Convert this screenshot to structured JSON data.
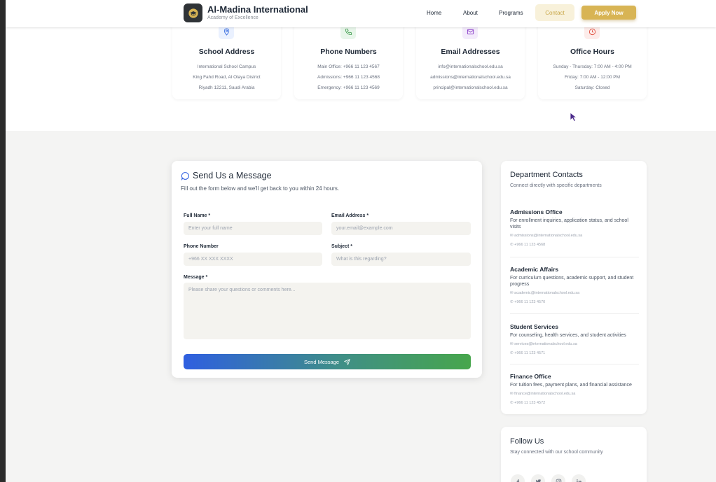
{
  "header": {
    "brand_name": "Al-Madina International",
    "brand_tagline": "Academy of Excellence",
    "nav": [
      "Home",
      "About",
      "Programs",
      "Contact"
    ],
    "apply_label": "Apply Now",
    "logo_icon": "graduation-cap-icon"
  },
  "info_cards": [
    {
      "icon": "map-pin-icon",
      "title": "School Address",
      "lines": [
        "International School Campus",
        "King Fahd Road, Al Olaya District",
        "Riyadh 12211, Saudi Arabia"
      ]
    },
    {
      "icon": "phone-icon",
      "title": "Phone Numbers",
      "lines": [
        "Main Office: +966 11 123 4567",
        "Admissions: +966 11 123 4568",
        "Emergency: +966 11 123 4569"
      ]
    },
    {
      "icon": "mail-icon",
      "title": "Email Addresses",
      "lines": [
        "info@internationalschool.edu.sa",
        "admissions@internationalschool.edu.sa",
        "principal@internationalschool.edu.sa"
      ]
    },
    {
      "icon": "clock-icon",
      "title": "Office Hours",
      "lines": [
        "Sunday - Thursday: 7:00 AM - 4:00 PM",
        "Friday: 7:00 AM - 12:00 PM",
        "Saturday: Closed"
      ]
    }
  ],
  "form": {
    "title": "Send Us a Message",
    "subtitle": "Fill out the form below and we'll get back to you within 24 hours.",
    "full_name_label": "Full Name *",
    "full_name_placeholder": "Enter your full name",
    "email_label": "Email Address *",
    "email_placeholder": "your.email@example.com",
    "phone_label": "Phone Number",
    "phone_placeholder": "+966 XX XXX XXXX",
    "subject_label": "Subject *",
    "subject_placeholder": "What is this regarding?",
    "message_label": "Message *",
    "message_placeholder": "Please share your questions or comments here...",
    "send_label": "Send Message"
  },
  "departments": {
    "title": "Department Contacts",
    "subtitle": "Connect directly with specific departments",
    "items": [
      {
        "name": "Admissions Office",
        "desc": "For enrollment inquiries, application status, and school visits",
        "email": "admissions@internationalschool.edu.sa",
        "phone": "+966 11 123 4568"
      },
      {
        "name": "Academic Affairs",
        "desc": "For curriculum questions, academic support, and student progress",
        "email": "academic@internationalschool.edu.sa",
        "phone": "+966 11 123 4570"
      },
      {
        "name": "Student Services",
        "desc": "For counseling, health services, and student activities",
        "email": "services@internationalschool.edu.sa",
        "phone": "+966 11 123 4571"
      },
      {
        "name": "Finance Office",
        "desc": "For tuition fees, payment plans, and financial assistance",
        "email": "finance@internationalschool.edu.sa",
        "phone": "+966 11 123 4572"
      }
    ]
  },
  "follow": {
    "title": "Follow Us",
    "subtitle": "Stay connected with our school community",
    "icons": [
      "facebook-icon",
      "twitter-icon",
      "instagram-icon",
      "linkedin-icon"
    ]
  },
  "colors": {
    "accent_gold": "#d8b454",
    "gradient_start": "#2f5fe0",
    "gradient_end": "#47a64c"
  }
}
